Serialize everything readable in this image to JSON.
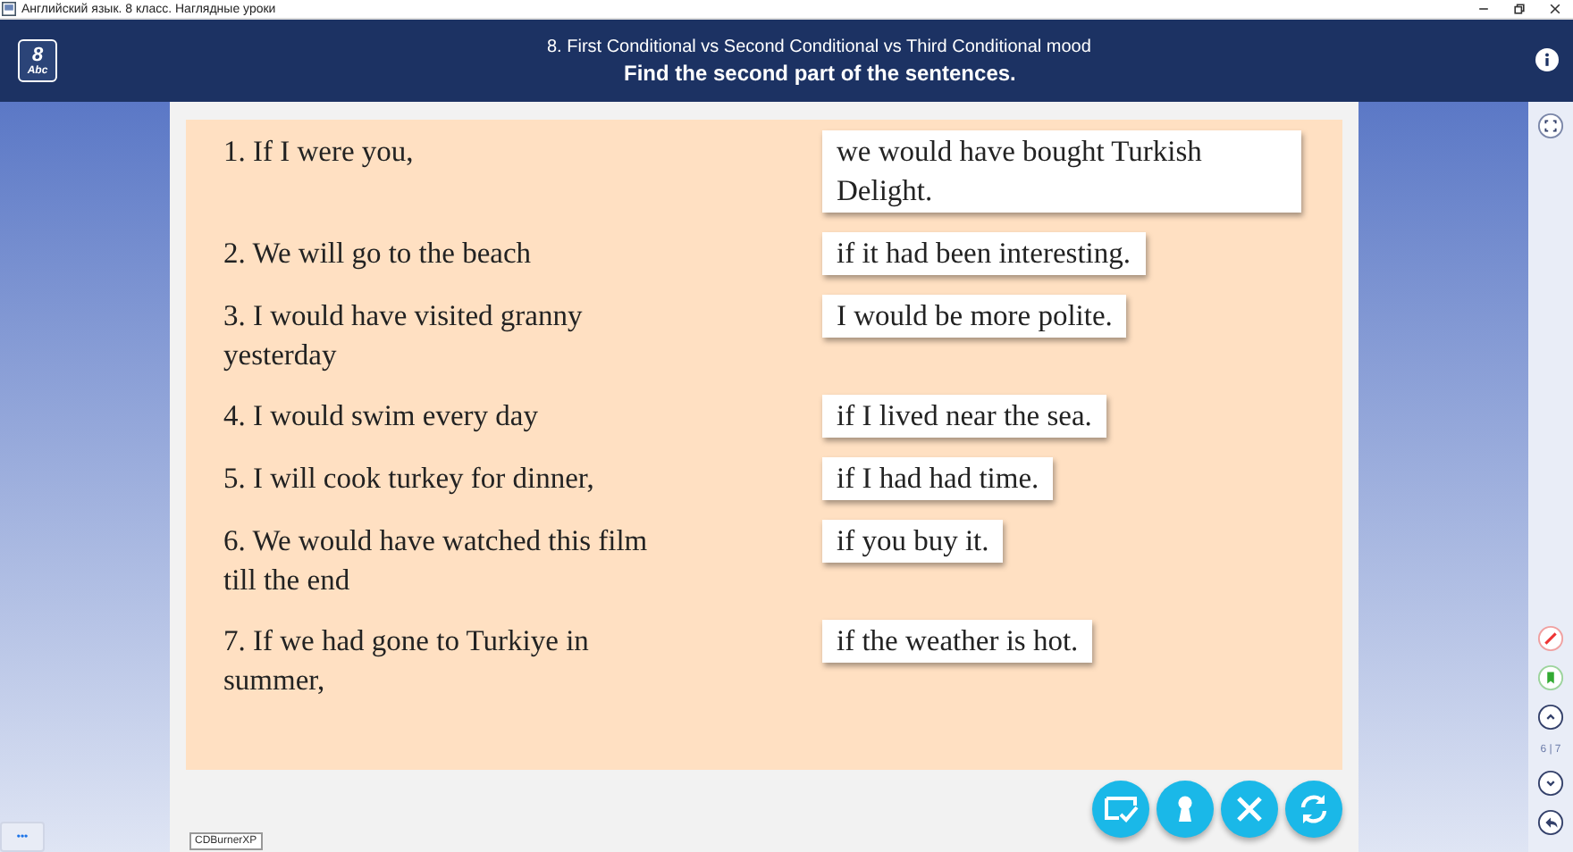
{
  "window": {
    "title": "Английский язык. 8 класс. Наглядные уроки"
  },
  "header": {
    "logo_number": "8",
    "logo_text": "Abc",
    "title": "8. First Conditional vs Second Conditional vs Third Conditional mood",
    "instruction": "Find the second part of the sentences."
  },
  "exercise": {
    "rows": [
      {
        "sentence": "1. If I were you,",
        "answer": "we would have bought Turkish Delight."
      },
      {
        "sentence": "2. We will go to the beach",
        "answer": "if it had been interesting."
      },
      {
        "sentence": "3. I would have visited granny yesterday",
        "answer": "I would be more polite."
      },
      {
        "sentence": "4. I would swim every day",
        "answer": "if I lived near the sea."
      },
      {
        "sentence": "5. I will cook turkey for dinner,",
        "answer": "if I had had time."
      },
      {
        "sentence": "6. We would have watched this film till the end",
        "answer": "if you buy it."
      },
      {
        "sentence": "7. If we had gone to Turkiye in summer,",
        "answer": "if the weather is hot."
      }
    ]
  },
  "sidebar": {
    "page_counter": "6 | 7"
  },
  "taskbar": {
    "more": "•••",
    "tooltip": "CDBurnerXP"
  }
}
